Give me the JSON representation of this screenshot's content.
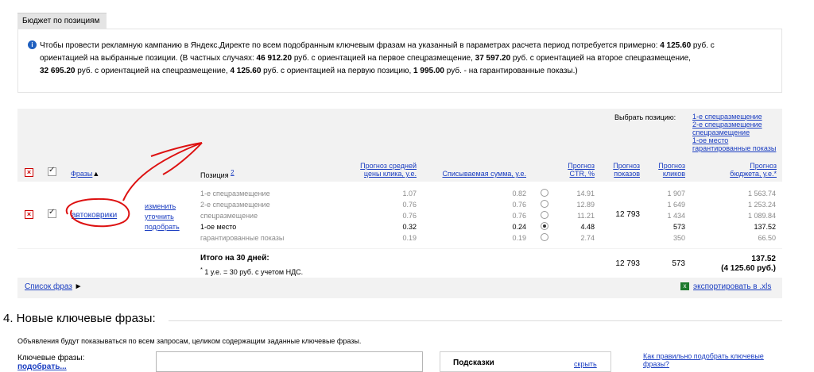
{
  "budget": {
    "tab_label": "Бюджет по позициям",
    "info_line1_a": "Чтобы провести рекламную кампанию в Яндекс.Директе по всем подобранным ключевым фразам на указанный в параметрах расчета период потребуется примерно: ",
    "info_line1_b": "4 125.60",
    "info_line1_c": " руб. с",
    "info_line2_a": "ориентацией на выбранные позиции. (В частных случаях: ",
    "info_line2_b": "46 912.20",
    "info_line2_c": " руб. с ориентацией на первое спецразмещение, ",
    "info_line2_d": "37 597.20",
    "info_line2_e": " руб. с ориентацией на второе спецразмещение,",
    "info_line3_a": "32 695.20",
    "info_line3_b": " руб. с ориентацией на спецразмещение, ",
    "info_line3_c": "4 125.60",
    "info_line3_d": " руб. с ориентацией на первую позицию, ",
    "info_line3_e": "1 995.00",
    "info_line3_f": " руб. - на гарантированные показы.)"
  },
  "table": {
    "choose_position_label": "Выбрать позицию:",
    "position_links": [
      "1-е спецразмещение",
      "2-е спецразмещение",
      "спецразмещение",
      "1-ое место",
      "гарантированные показы"
    ],
    "headers": {
      "phrases": "Фразы",
      "position": "Позиция",
      "position_note": "2",
      "avg_cpc_l1": "Прогноз средней",
      "avg_cpc_l2": "цены клика, у.е.",
      "charged_sum": "Списываемая сумма, у.е.",
      "ctr_l1": "Прогноз",
      "ctr_l2": "CTR, %",
      "impressions_l1": "Прогноз",
      "impressions_l2": "показов",
      "clicks_l1": "Прогноз",
      "clicks_l2": "кликов",
      "budget_l1": "Прогноз",
      "budget_l2": "бюджета, у.е.*"
    },
    "keyword": "автоковрики",
    "keyword_actions": [
      "изменить",
      "уточнить",
      "подобрать"
    ],
    "impressions": "12 793",
    "rows": [
      {
        "position": "1-е спецразмещение",
        "cpc": "1.07",
        "charged": "0.82",
        "ctr": "14.91",
        "clicks": "1 907",
        "budget": "1 563.74",
        "selected": false
      },
      {
        "position": "2-е спецразмещение",
        "cpc": "0.76",
        "charged": "0.76",
        "ctr": "12.89",
        "clicks": "1 649",
        "budget": "1 253.24",
        "selected": false
      },
      {
        "position": "спецразмещение",
        "cpc": "0.76",
        "charged": "0.76",
        "ctr": "11.21",
        "clicks": "1 434",
        "budget": "1 089.84",
        "selected": false
      },
      {
        "position": "1-ое место",
        "cpc": "0.32",
        "charged": "0.24",
        "ctr": "4.48",
        "clicks": "573",
        "budget": "137.52",
        "selected": true
      },
      {
        "position": "гарантированные показы",
        "cpc": "0.19",
        "charged": "0.19",
        "ctr": "2.74",
        "clicks": "350",
        "budget": "66.50",
        "selected": false
      }
    ],
    "total_label": "Итого на 30 дней:",
    "total_note": " 1 у.е. = 30 руб. с учетом НДС.",
    "total_note_star": "*",
    "total_impressions": "12 793",
    "total_clicks": "573",
    "total_budget": "137.52",
    "total_budget_rub": "(4 125.60 руб.)",
    "phrase_list_link": "Список фраз",
    "export_link": "экспортировать в .xls"
  },
  "new_keywords": {
    "title": "4. Новые ключевые фразы:",
    "description": "Объявления будут показываться по всем запросам, целиком содержащим заданные ключевые фразы.",
    "keywords_label": "Ключевые фразы:",
    "pick_link": "подобрать...",
    "hints_title": "Подсказки",
    "hide_link": "скрыть",
    "howto_link_l1": "Как правильно подобрать ключевые",
    "howto_link_l2": "фразы?"
  },
  "colors": {
    "link": "#1a3dc1",
    "annotation": "#dd1111",
    "table_bg": "#f2f2f2",
    "tab_bg": "#e4e4e4"
  }
}
